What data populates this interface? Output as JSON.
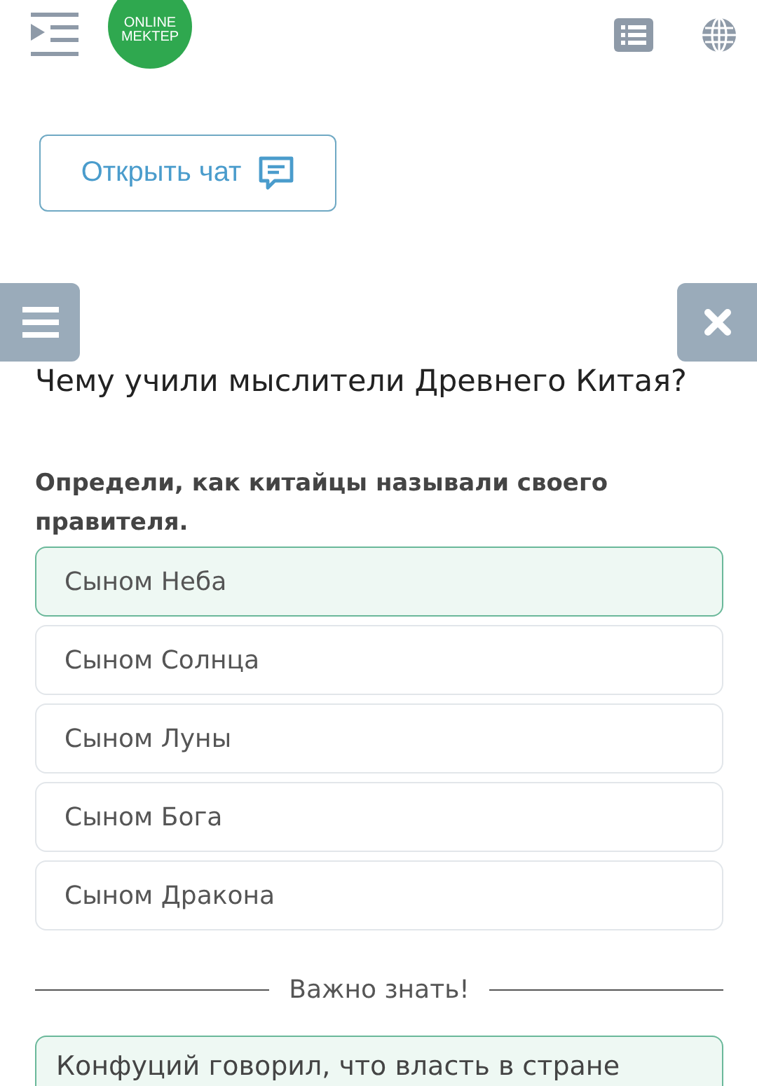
{
  "header": {
    "logo_lines": [
      "ONLINE",
      "MEKTEP"
    ]
  },
  "chat_button": {
    "label": "Открыть чат"
  },
  "title": "Чему учили мыслители Древнего Китая?",
  "question": "Определи, как китайцы называли своего правителя.",
  "options": [
    {
      "label": "Сыном Неба",
      "selected": true
    },
    {
      "label": "Сыном Солнца",
      "selected": false
    },
    {
      "label": "Сыном Луны",
      "selected": false
    },
    {
      "label": "Сыном Бога",
      "selected": false
    },
    {
      "label": "Сыном Дракона",
      "selected": false
    }
  ],
  "divider_label": "Важно знать!",
  "info_text": "Конфуций говорил, что власть в стране"
}
